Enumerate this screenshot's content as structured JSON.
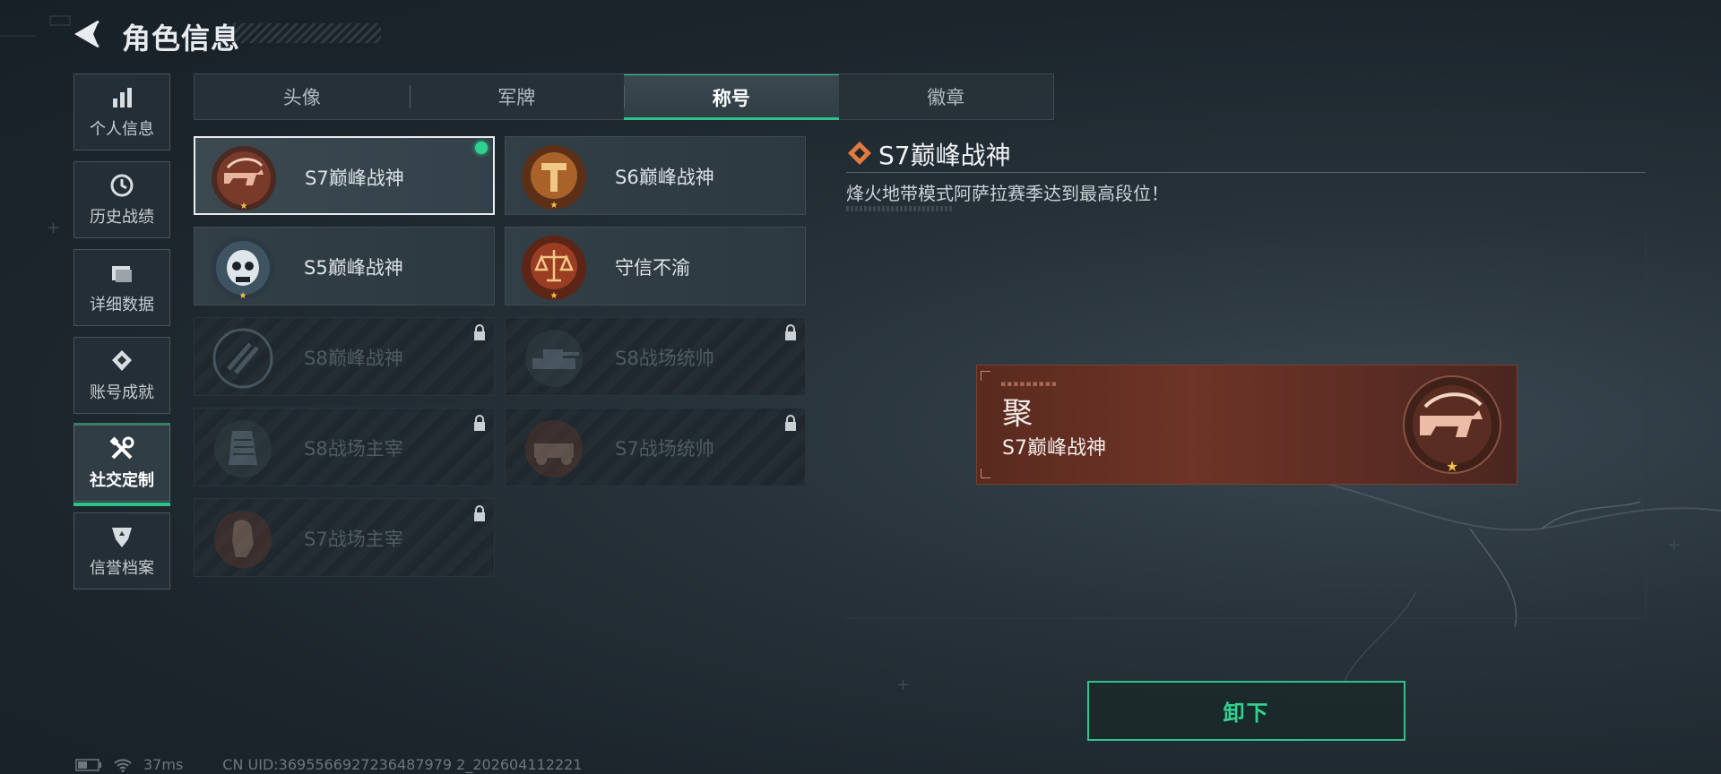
{
  "header": {
    "title": "角色信息"
  },
  "sidebar": {
    "items": [
      {
        "label": "个人信息",
        "icon": "bar-chart-icon",
        "active": false
      },
      {
        "label": "历史战绩",
        "icon": "history-icon",
        "active": false
      },
      {
        "label": "详细数据",
        "icon": "folder-icon",
        "active": false
      },
      {
        "label": "账号成就",
        "icon": "achievement-icon",
        "active": false
      },
      {
        "label": "社交定制",
        "icon": "tools-icon",
        "active": true
      },
      {
        "label": "信誉档案",
        "icon": "credit-shield-icon",
        "active": false
      }
    ]
  },
  "tabs": [
    {
      "label": "头像",
      "active": false
    },
    {
      "label": "军牌",
      "active": false
    },
    {
      "label": "称号",
      "active": true
    },
    {
      "label": "徽章",
      "active": false
    }
  ],
  "titles": [
    {
      "name": "S7巅峰战神",
      "emblem": "gun-emblem-icon",
      "locked": false,
      "selected": true,
      "equipped": true
    },
    {
      "name": "S6巅峰战神",
      "emblem": "t-emblem-icon",
      "locked": false,
      "selected": false,
      "equipped": false
    },
    {
      "name": "S5巅峰战神",
      "emblem": "skull-emblem-icon",
      "locked": false,
      "selected": false,
      "equipped": false
    },
    {
      "name": "守信不渝",
      "emblem": "scales-emblem-icon",
      "locked": false,
      "selected": false,
      "equipped": false
    },
    {
      "name": "S8巅峰战神",
      "emblem": "slash-emblem-icon",
      "locked": true,
      "selected": false,
      "equipped": false
    },
    {
      "name": "S8战场统帅",
      "emblem": "tank-emblem-icon",
      "locked": true,
      "selected": false,
      "equipped": false
    },
    {
      "name": "S8战场主宰",
      "emblem": "tower-emblem-icon",
      "locked": true,
      "selected": false,
      "equipped": false
    },
    {
      "name": "S7战场统帅",
      "emblem": "vehicle-emblem-icon",
      "locked": true,
      "selected": false,
      "equipped": false
    },
    {
      "name": "S7战场主宰",
      "emblem": "soldier-emblem-icon",
      "locked": true,
      "selected": false,
      "equipped": false
    }
  ],
  "detail": {
    "title": "S7巅峰战神",
    "description": "烽火地带模式阿萨拉赛季达到最高段位！",
    "preview": {
      "glyph": "聚",
      "name": "S7巅峰战神"
    },
    "action_label": "卸下"
  },
  "status": {
    "ping": "37ms",
    "uid": "CN UID:3695566927236487979 2_202604112221"
  },
  "colors": {
    "accent": "#2fc38a",
    "card_brown": "#6d3427",
    "equipped_dot": "#2ed18e"
  }
}
